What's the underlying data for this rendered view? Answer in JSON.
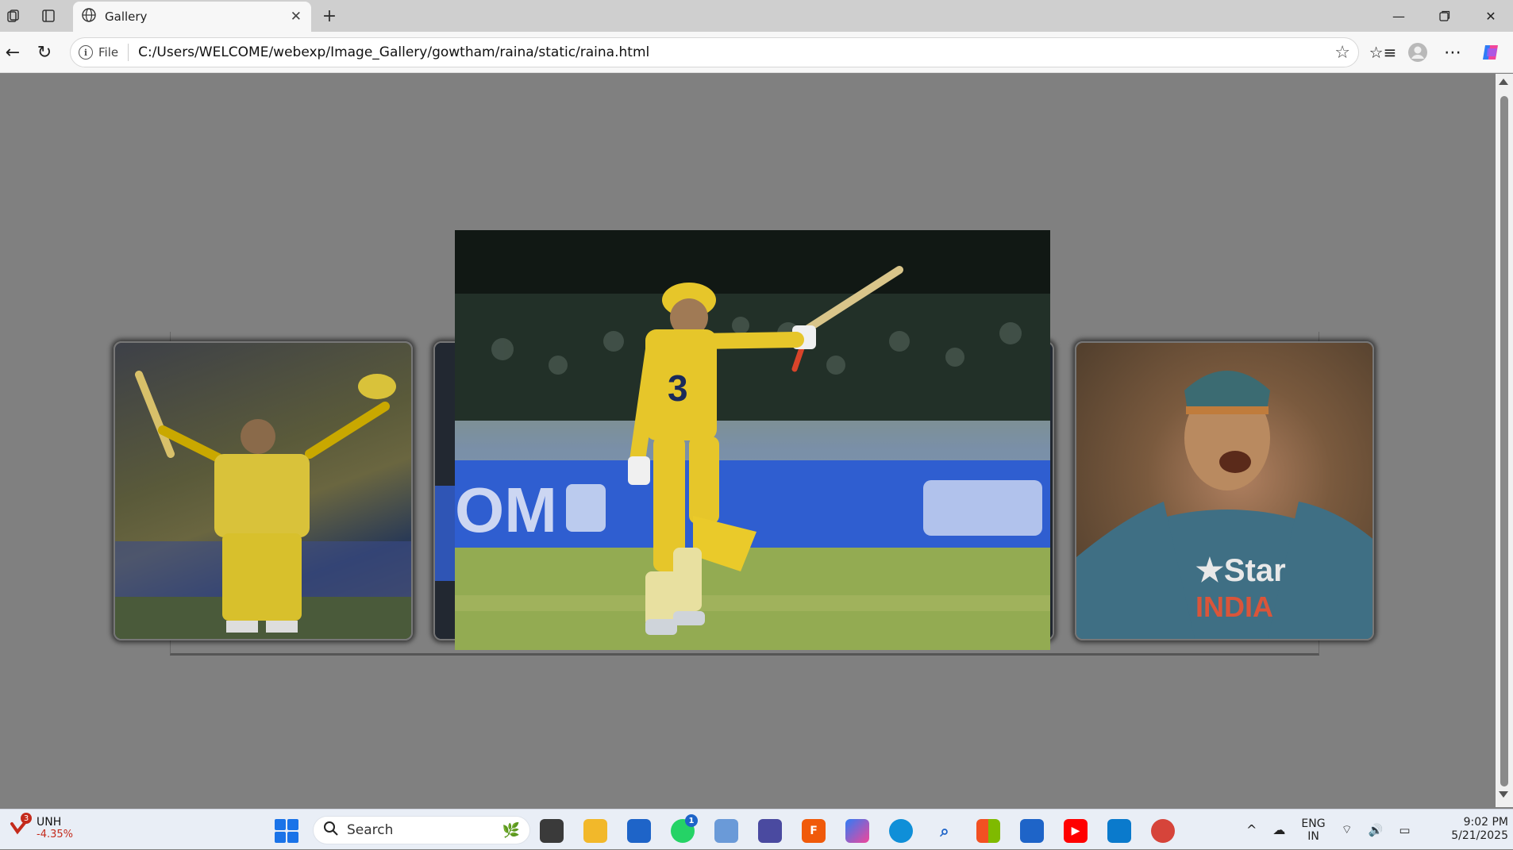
{
  "browser": {
    "tab_title": "Gallery",
    "file_label": "File",
    "url": "C:/Users/WELCOME/webexp/Image_Gallery/gowtham/raina/static/raina.html"
  },
  "gallery": {
    "images": [
      {
        "name": "raina-celebrating-yellow"
      },
      {
        "name": "raina-partial-hidden"
      },
      {
        "name": "raina-india-jersey"
      }
    ],
    "featured": {
      "name": "raina-walking-bat-raised"
    }
  },
  "taskbar": {
    "stock_symbol": "UNH",
    "stock_change": "-4.35%",
    "stock_badge": "3",
    "search_placeholder": "Search",
    "whatsapp_badge": "1",
    "language": "ENG",
    "region": "IN",
    "time": "9:02 PM",
    "date": "5/21/2025"
  }
}
